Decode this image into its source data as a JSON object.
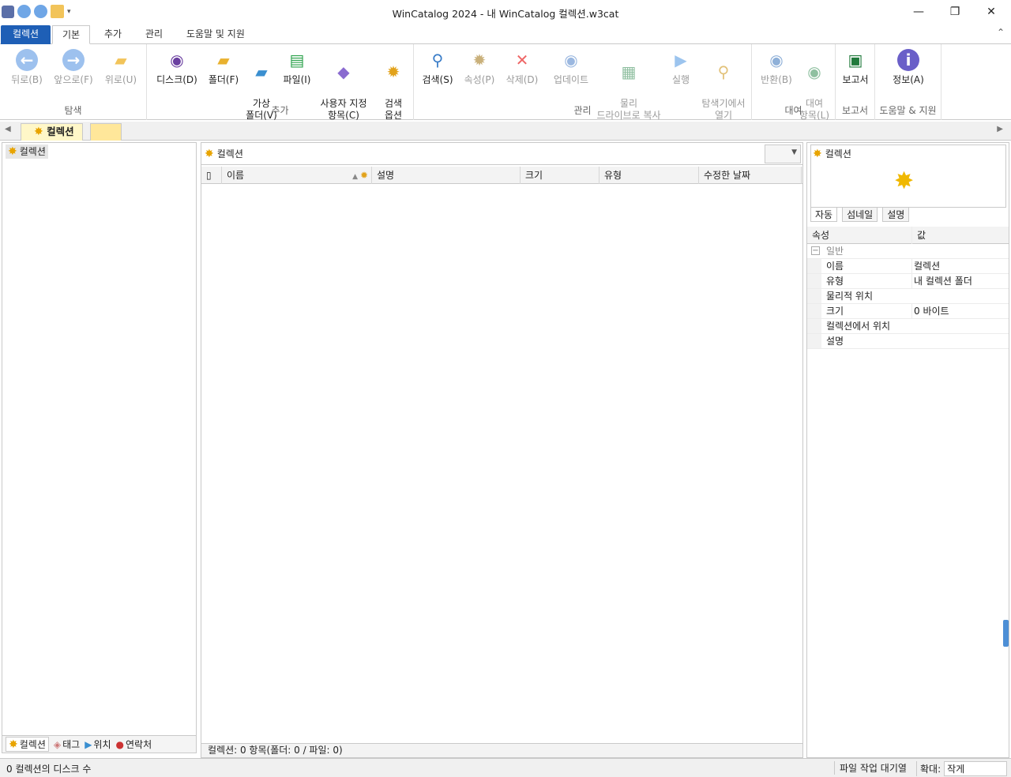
{
  "window": {
    "title": "WinCatalog 2024 - 내 WinCatalog 컬렉션.w3cat",
    "minimize": "—",
    "maximize": "❐",
    "close": "✕"
  },
  "tabs": {
    "file": "컬렉션",
    "items": [
      "기본",
      "추가",
      "관리",
      "도움말 및 지원"
    ],
    "active": "기본",
    "collapse_glyph": "⌃"
  },
  "ribbon": {
    "groups": {
      "navigate": {
        "label": "탐색",
        "buttons": [
          "뒤로(B)",
          "앞으로(F)",
          "위로(U)"
        ]
      },
      "add": {
        "label": "추가",
        "buttons": [
          "디스크(D)",
          "폴더(F)",
          "가상\n폴더(V)",
          "파일(I)",
          "사용자 지정\n항목(C)",
          "검색\n옵션"
        ]
      },
      "manage": {
        "label": "관리",
        "buttons": [
          "검색(S)",
          "속성(P)",
          "삭제(D)",
          "업데이트",
          "물리\n드라이브로 복사",
          "실행",
          "탐색기에서\n열기"
        ]
      },
      "lend": {
        "label": "대여",
        "buttons": [
          "반환(B)",
          "대여\n항목(L)"
        ]
      },
      "report": {
        "label": "보고서",
        "buttons": [
          "보고서"
        ]
      },
      "help": {
        "label": "도움말 & 지원",
        "buttons": [
          "정보(A)"
        ]
      }
    }
  },
  "doc_tab": {
    "label": "컬렉션"
  },
  "left_pane": {
    "tree_root": "컬렉션",
    "bottom_tabs": [
      "컬렉션",
      "태그",
      "위치",
      "연락처"
    ]
  },
  "center_pane": {
    "address": "컬렉션",
    "columns": [
      "이름",
      "설명",
      "크기",
      "유형",
      "수정한 날짜"
    ],
    "status": "컬렉션: 0 항목(폴더: 0 / 파일: 0)"
  },
  "right_pane": {
    "preview_title": "컬렉션",
    "preview_tabs": [
      "자동",
      "섬네일",
      "설명"
    ],
    "prop_header": {
      "key": "속성",
      "value": "값"
    },
    "category": "일반",
    "properties": [
      {
        "key": "이름",
        "value": "컬렉션"
      },
      {
        "key": "유형",
        "value": "내 컬렉션 폴더"
      },
      {
        "key": "물리적 위치",
        "value": ""
      },
      {
        "key": "크기",
        "value": "0 바이트"
      },
      {
        "key": "컬렉션에서 위치",
        "value": ""
      },
      {
        "key": "설명",
        "value": ""
      }
    ]
  },
  "statusbar": {
    "left": "0 컬렉션의 디스크 수",
    "queue": "파일 작업 대기열",
    "zoom_label": "확대:",
    "zoom_value": "작게"
  },
  "colors": {
    "file_tab": "#1e5fb6",
    "nav_blue": "#4d8fd6",
    "star_yellow": "#f0b800"
  }
}
